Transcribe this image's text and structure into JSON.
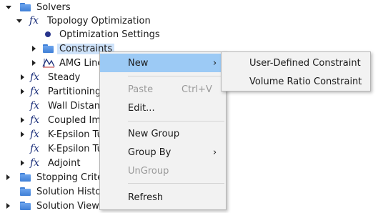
{
  "tree": {
    "solvers": "Solvers",
    "topology_optimization": "Topology Optimization",
    "optimization_settings": "Optimization Settings",
    "constraints": "Constraints",
    "amg": "AMG Line",
    "steady": "Steady",
    "partitioning": "Partitioning",
    "wall_distance": "Wall Distanc",
    "coupled": "Coupled Imp",
    "kepsilon1": "K-Epsilon Tu",
    "kepsilon2": "K-Epsilon Tu",
    "adjoint": "Adjoint",
    "stopping": "Stopping Criter",
    "solution_history": "Solution Histor",
    "solution_views": "Solution Views",
    "fx_symbol": "fx"
  },
  "context_menu": {
    "new": "New",
    "paste": "Paste",
    "paste_shortcut": "Ctrl+V",
    "edit": "Edit...",
    "new_group": "New Group",
    "group_by": "Group By",
    "ungroup": "UnGroup",
    "refresh": "Refresh",
    "submenu_arrow": "›"
  },
  "submenu": {
    "user_defined": "User-Defined Constraint",
    "volume_ratio": "Volume Ratio Constraint"
  }
}
